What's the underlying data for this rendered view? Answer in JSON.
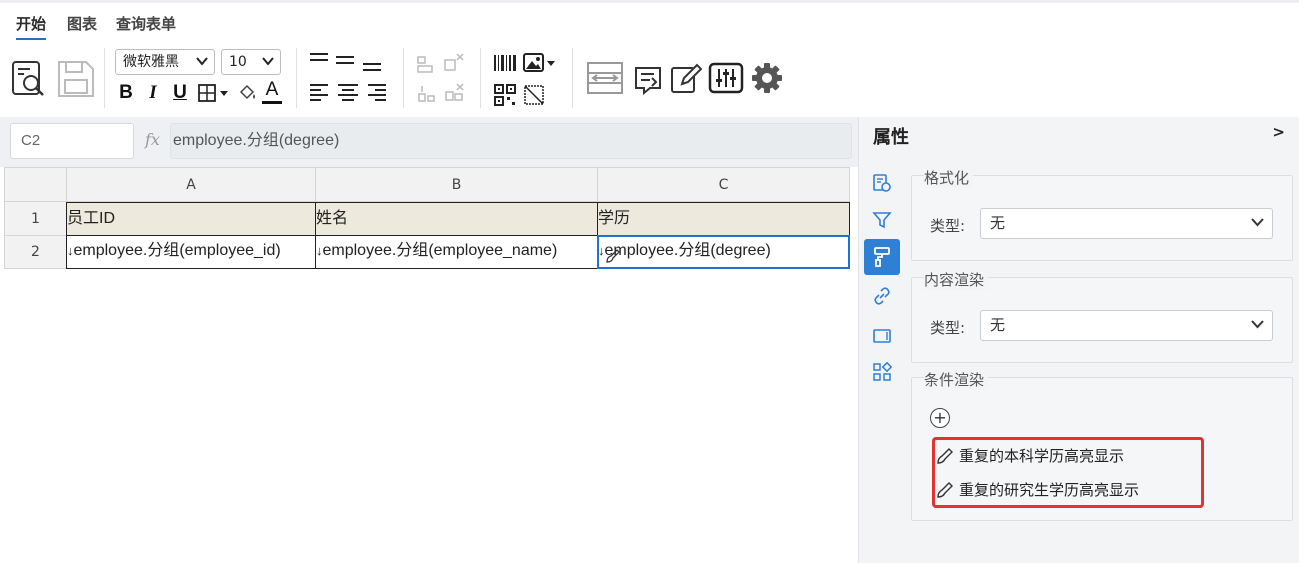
{
  "menu": {
    "tabs": [
      {
        "label": "开始",
        "active": true
      },
      {
        "label": "图表",
        "active": false
      },
      {
        "label": "查询表单",
        "active": false
      }
    ]
  },
  "toolbar": {
    "font_family": "微软雅黑",
    "font_size": "10",
    "bold_label": "B",
    "italic_label": "I",
    "underline_label": "U",
    "font_color_label": "A",
    "accent_color": "#2a6fb5"
  },
  "formula_bar": {
    "cell_ref": "C2",
    "fx_label": "fx",
    "formula": "employee.分组(degree)"
  },
  "sheet": {
    "columns": [
      "A",
      "B",
      "C"
    ],
    "rows": [
      "1",
      "2"
    ],
    "header_row": [
      "员工ID",
      "姓名",
      "学历"
    ],
    "data_row": [
      "employee.分组(employee_id)",
      "employee.分组(employee_name)",
      "employee.分组(degree)"
    ],
    "group_marker": "↓",
    "selected_cell": "C2",
    "header_bg": "#ede9dc",
    "selection_color": "#1e73d0"
  },
  "panel": {
    "title": "属性",
    "collapse_glyph": ">",
    "side_icons": [
      "data-settings-icon",
      "filter-icon",
      "format-painter-icon",
      "link-icon",
      "frame-icon",
      "widgets-icon"
    ],
    "active_side_icon": "format-painter-icon",
    "active_color": "#2f7fd5",
    "format_section": {
      "title": "格式化",
      "type_label": "类型:",
      "type_value": "无"
    },
    "render_section": {
      "title": "内容渲染",
      "type_label": "类型:",
      "type_value": "无"
    },
    "condition_section": {
      "title": "条件渲染",
      "add_glyph": "+",
      "rules": [
        "重复的本科学历高亮显示",
        "重复的研究生学历高亮显示"
      ],
      "highlight_color": "#e53131"
    }
  }
}
